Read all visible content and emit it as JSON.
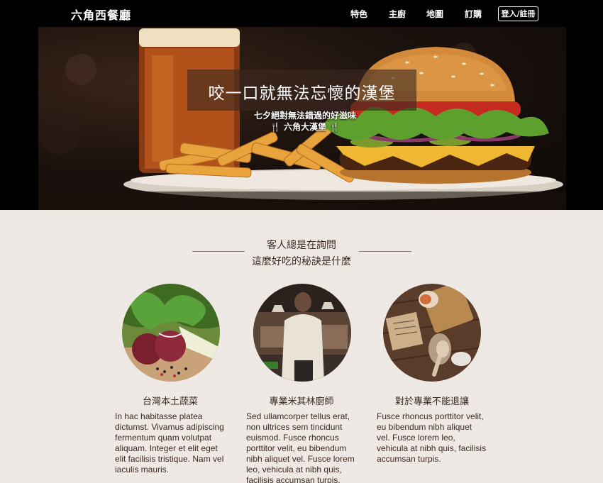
{
  "nav": {
    "brand": "六角西餐廳",
    "items": [
      "特色",
      "主廚",
      "地圖",
      "訂購"
    ],
    "login": "登入/註冊"
  },
  "hero": {
    "title": "咬一口就無法忘懷的漢堡",
    "subtitle": "七夕絕對無法錯過的好滋味",
    "tagline": "🍴 六角大漢堡 🍴"
  },
  "section": {
    "heading_line1": "客人總是在詢問",
    "heading_line2": "這麼好吃的秘訣是什麼"
  },
  "features": [
    {
      "title": "台灣本土蔬菜",
      "text": "In hac habitasse platea dictumst. Vivamus adipiscing fermentum quam volutpat aliquam. Integer et elit eget elit facilisis tristique. Nam vel iaculis mauris."
    },
    {
      "title": "專業米其林廚師",
      "text": "Sed ullamcorper tellus erat, non ultrices sem tincidunt euismod. Fusce rhoncus porttitor velit, eu bibendum nibh aliquet vel. Fusce lorem leo, vehicula at nibh quis, facilisis accumsan turpis."
    },
    {
      "title": "對於專業不能退讓",
      "text": "Fusce rhoncus porttitor velit, eu bibendum nibh aliquet vel. Fusce lorem leo, vehicula at nibh quis, facilisis accumsan turpis."
    }
  ]
}
